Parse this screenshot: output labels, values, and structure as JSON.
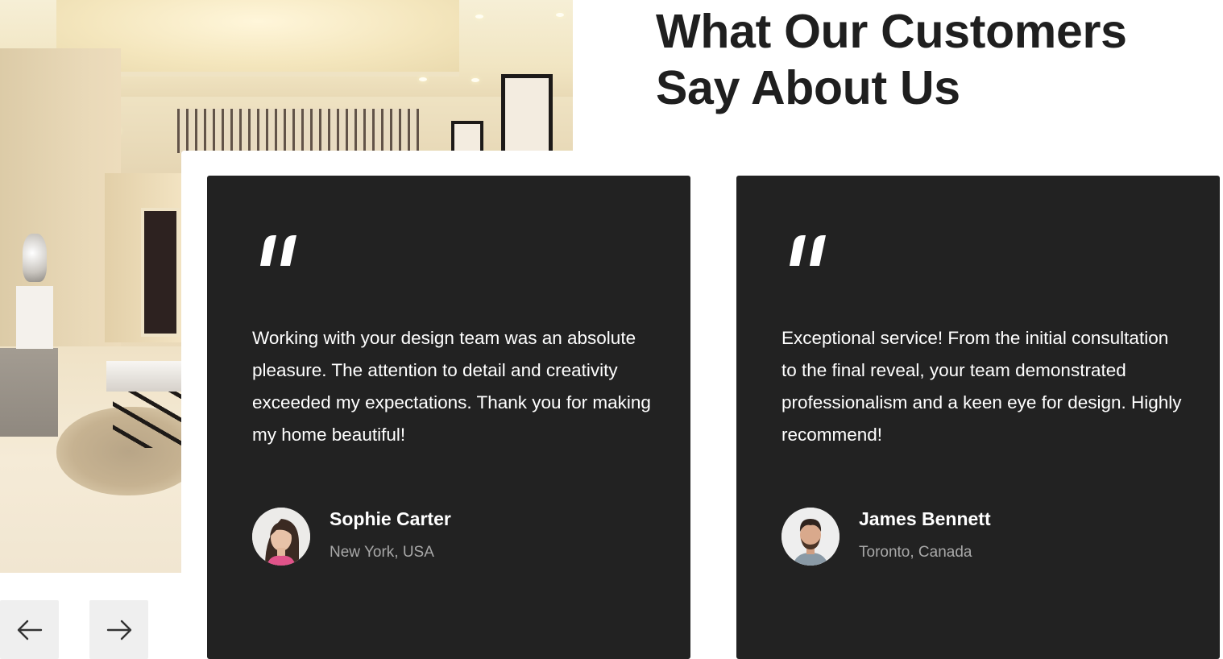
{
  "section": {
    "title_line1": "What Our Customers",
    "title_line2": "Say About Us"
  },
  "testimonials": [
    {
      "quote": "Working with your design team was an absolute pleasure. The attention to detail and creativity exceeded my expectations. Thank you for making my home beautiful!",
      "name": "Sophie Carter",
      "location": "New York, USA",
      "avatar_icon": "avatar-woman"
    },
    {
      "quote": "Exceptional service! From the initial consultation to the final reveal, your team demonstrated professionalism and a keen eye for design. Highly recommend!",
      "name": "James Bennett",
      "location": "Toronto, Canada",
      "avatar_icon": "avatar-man"
    }
  ],
  "navigation": {
    "prev_icon": "arrow-left-icon",
    "next_icon": "arrow-right-icon"
  },
  "colors": {
    "card_background": "#222222",
    "title_color": "#1f1f1f",
    "location_color": "#a8a8a8",
    "nav_button_background": "#efefef"
  }
}
